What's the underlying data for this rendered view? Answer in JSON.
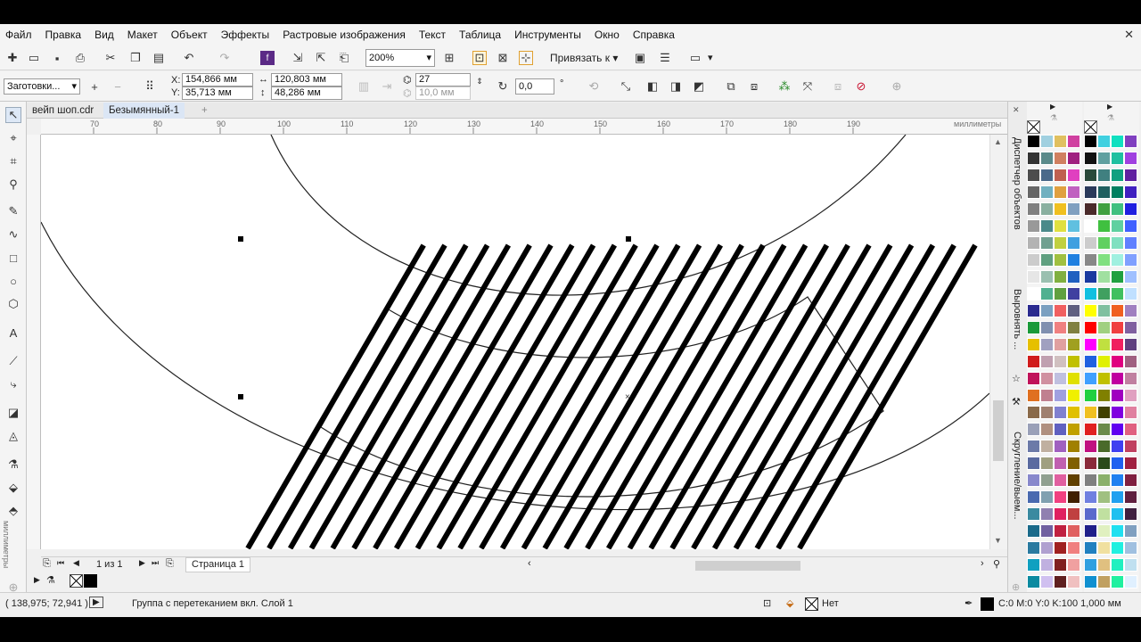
{
  "menu": [
    "Файл",
    "Правка",
    "Вид",
    "Макет",
    "Объект",
    "Эффекты",
    "Растровые изображения",
    "Текст",
    "Таблица",
    "Инструменты",
    "Окно",
    "Справка"
  ],
  "toolbar": {
    "zoom": "200%",
    "snap_label": "Привязать к"
  },
  "propbar": {
    "preset": "Заготовки...",
    "x_label": "X:",
    "x_value": "154,866 мм",
    "y_label": "Y:",
    "y_value": "35,713 мм",
    "w_value": "120,803 мм",
    "h_value": "48,286 мм",
    "steps_value": "27",
    "offset_value": "10,0 мм",
    "angle_value": "0,0",
    "degree": "°"
  },
  "tabs": [
    "вейп шоп.cdr",
    "Безымянный-1"
  ],
  "ruler": {
    "ticks": [
      "70",
      "80",
      "90",
      "100",
      "110",
      "120",
      "130",
      "140",
      "150",
      "160",
      "170",
      "180",
      "190"
    ],
    "unit": "миллиметры",
    "vunit": "миллиметры"
  },
  "pages": {
    "count": "1 из 1",
    "page_tab": "Страница 1"
  },
  "dockers": [
    "Диспетчер объектов",
    "Выровнять ...",
    "Скругление/выем..."
  ],
  "status": {
    "coords": "( 138,975; 72,941 )",
    "info": "Группа с перетеканием вкл. Слой 1",
    "fill_label": "Нет",
    "outline": "C:0 M:0 Y:0 K:100  1,000 мм"
  },
  "colors": {
    "accent": "#2a63c4",
    "highlight": "#fff200"
  },
  "hatch": {
    "count": 27,
    "angle_deg": 55
  }
}
